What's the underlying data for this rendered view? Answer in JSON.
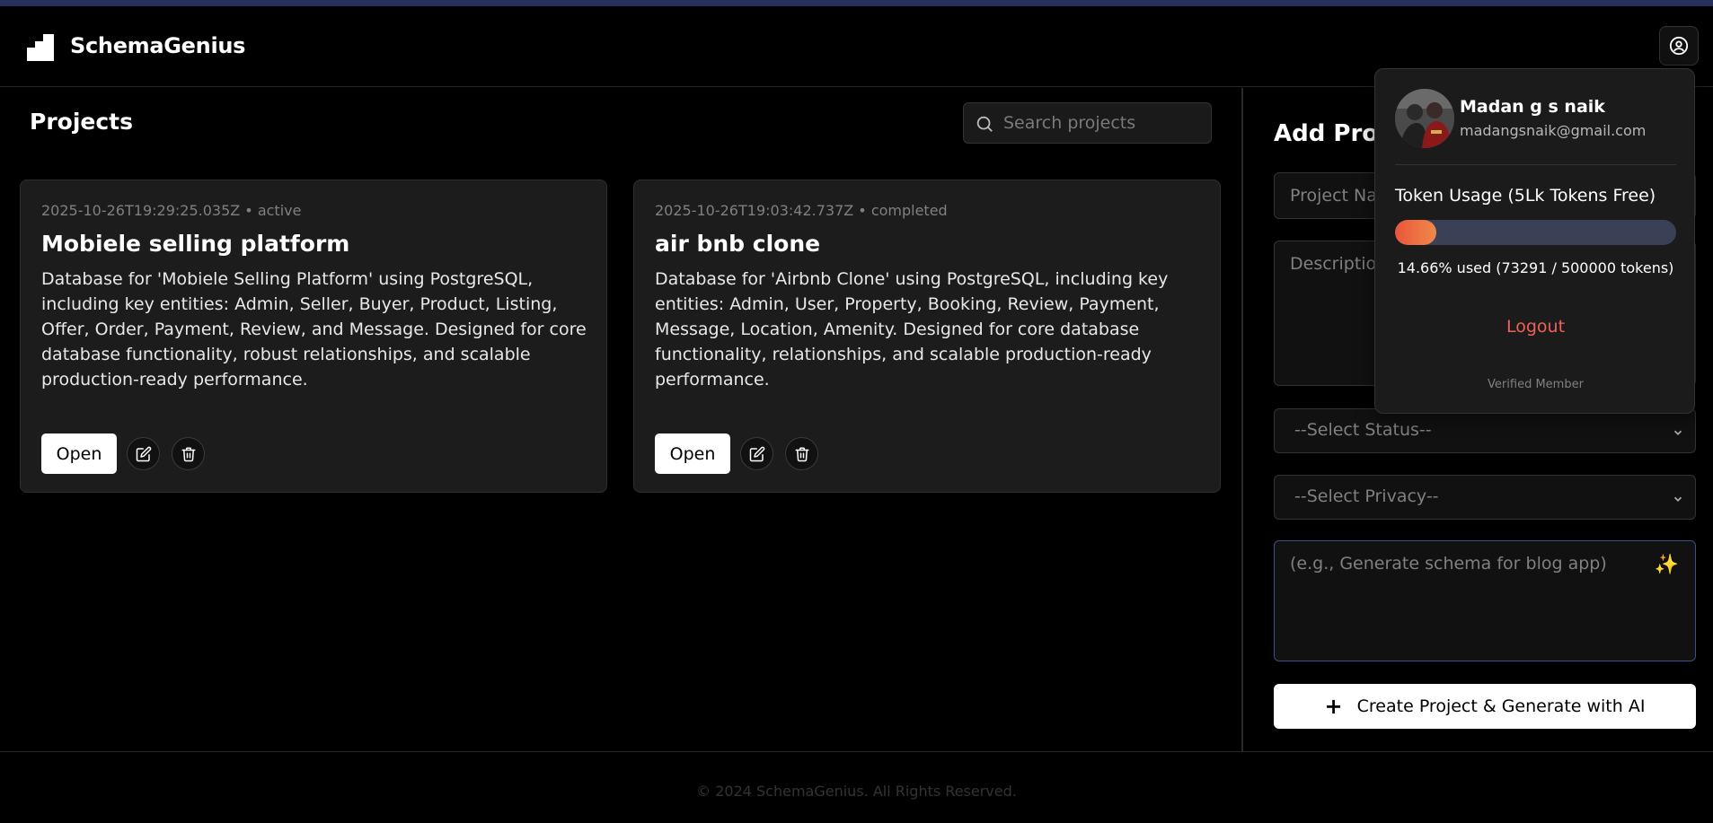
{
  "app": {
    "brand": "SchemaGenius"
  },
  "header": {
    "user_icon": "user-circle-icon"
  },
  "projects": {
    "title": "Projects",
    "search_placeholder": "Search projects",
    "items": [
      {
        "date": "2025-10-26T19:29:25.035Z",
        "status": "active",
        "meta": "2025-10-26T19:29:25.035Z • active",
        "name": "Mobiele selling platform",
        "description": "Database for 'Mobiele Selling Platform' using PostgreSQL, including key entities: Admin, Seller, Buyer, Product, Listing, Offer, Order, Payment, Review, and Message. Designed for core database functionality, robust relationships, and scalable production-ready performance.",
        "open_label": "Open"
      },
      {
        "date": "2025-10-26T19:03:42.737Z",
        "status": "completed",
        "meta": "2025-10-26T19:03:42.737Z • completed",
        "name": "air bnb clone",
        "description": "Database for 'Airbnb Clone' using PostgreSQL, including key entities: Admin, User, Property, Booking, Review, Payment, Message, Location, Amenity. Designed for core database functionality, relationships, and scalable production-ready performance.",
        "open_label": "Open"
      }
    ]
  },
  "add_project": {
    "title": "Add Project",
    "name_placeholder": "Project Name",
    "description_placeholder": "Description",
    "status_select": "--Select Status--",
    "privacy_select": "--Select Privacy--",
    "prompt_placeholder": "(e.g., Generate schema for blog app)",
    "create_label": "Create Project & Generate with AI"
  },
  "user_menu": {
    "name": "Madan g s naik",
    "email": "madangsnaik@gmail.com",
    "token_title": "Token Usage (5Lk Tokens Free)",
    "token_percent": 14.66,
    "token_used": 73291,
    "token_total": 500000,
    "token_text": "14.66% used (73291 / 500000 tokens)",
    "logout": "Logout",
    "verified": "Verified Member"
  },
  "footer": {
    "copyright": "© 2024 SchemaGenius. All Rights Reserved."
  },
  "colors": {
    "accent_logout": "#f0615a",
    "progress_fill": "#e8563a",
    "progress_track": "#3a4156"
  }
}
